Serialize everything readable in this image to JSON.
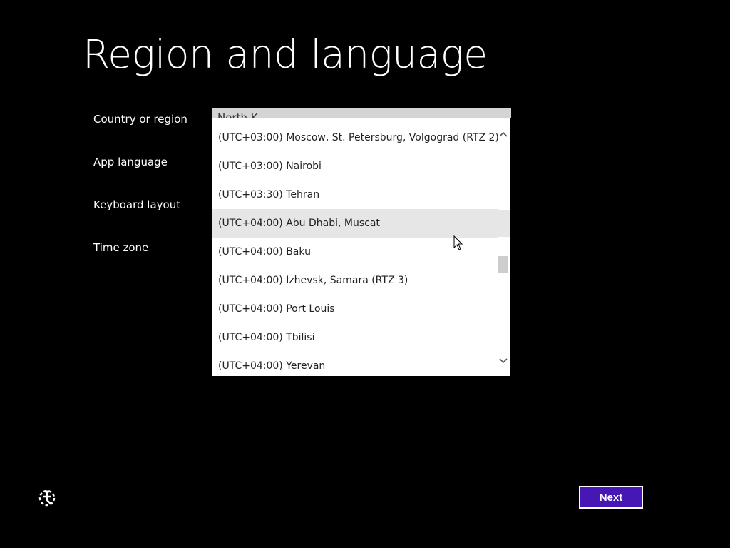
{
  "page": {
    "title": "Region and language"
  },
  "fields": {
    "country_label": "Country or region",
    "app_language_label": "App language",
    "keyboard_label": "Keyboard layout",
    "timezone_label": "Time zone",
    "country_value_partial": "North K..."
  },
  "timezone_dropdown": {
    "items": [
      "(UTC+03:00) Moscow, St. Petersburg, Volgograd (RTZ 2)",
      "(UTC+03:00) Nairobi",
      "(UTC+03:30) Tehran",
      "(UTC+04:00) Abu Dhabi, Muscat",
      "(UTC+04:00) Baku",
      "(UTC+04:00) Izhevsk, Samara (RTZ 3)",
      "(UTC+04:00) Port Louis",
      "(UTC+04:00) Tbilisi",
      "(UTC+04:00) Yerevan"
    ],
    "hovered_item": "(UTC+04:00) Abu Dhabi, Muscat",
    "scroll_up_icon": "chevron-up-icon",
    "scroll_down_icon": "chevron-down-icon"
  },
  "footer": {
    "next_label": "Next",
    "ease_access_icon": "ease-of-access-icon"
  },
  "colors": {
    "background": "#000000",
    "accent": "#4617b4",
    "dropdown_bg": "#ffffff",
    "hover_bg": "#e6e6e6"
  }
}
